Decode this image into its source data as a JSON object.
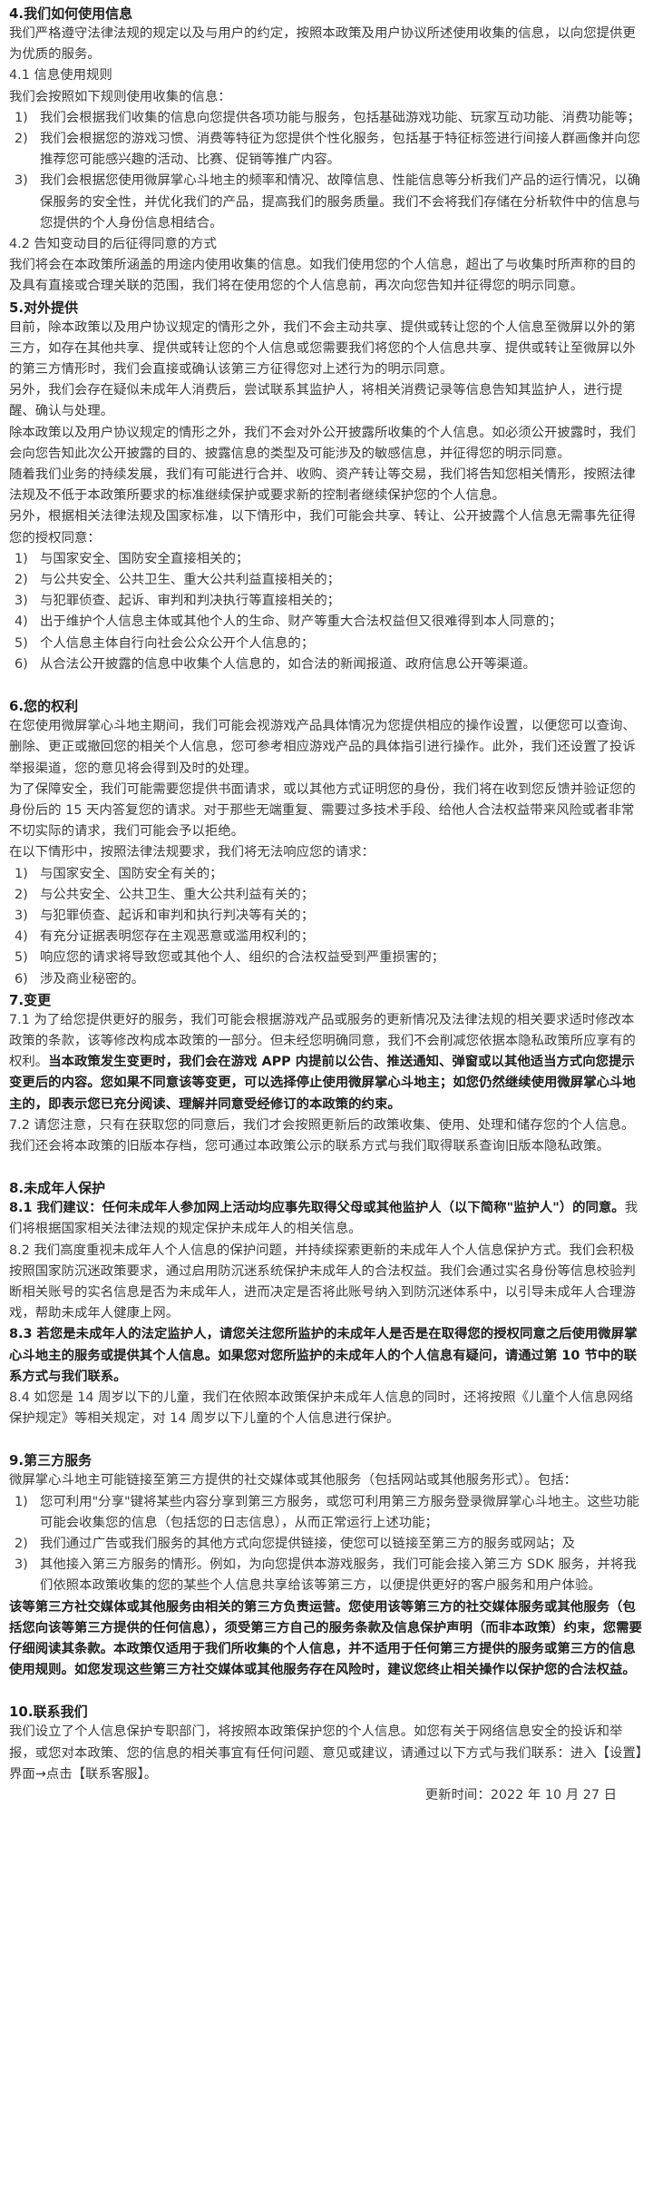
{
  "s4": {
    "title": "4.我们如何使用信息",
    "intro": "我们严格遵守法律法规的规定以及与用户的约定，按照本政策及用户协议所述使用收集的信息，以向您提供更为优质的服务。",
    "s41_title": "4.1 信息使用规则",
    "s41_intro": "我们会按照如下规则使用收集的信息：",
    "items": [
      {
        "n": "1)",
        "t": "我们会根据我们收集的信息向您提供各项功能与服务，包括基础游戏功能、玩家互动功能、消费功能等；"
      },
      {
        "n": "2)",
        "t": "我们会根据您的游戏习惯、消费等特征为您提供个性化服务，包括基于特征标签进行间接人群画像并向您推荐您可能感兴趣的活动、比赛、促销等推广内容。"
      },
      {
        "n": "3)",
        "t": "我们会根据您使用微屏掌心斗地主的频率和情况、故障信息、性能信息等分析我们产品的运行情况，以确保服务的安全性，并优化我们的产品，提高我们的服务质量。我们不会将我们存储在分析软件中的信息与您提供的个人身份信息相结合。"
      }
    ],
    "s42_title": "4.2 告知变动目的后征得同意的方式",
    "s42_text": "我们将会在本政策所涵盖的用途内使用收集的信息。如我们使用您的个人信息，超出了与收集时所声称的目的及具有直接或合理关联的范围，我们将在使用您的个人信息前，再次向您告知并征得您的明示同意。"
  },
  "s5": {
    "title": "5.对外提供",
    "p1": "目前，除本政策以及用户协议规定的情形之外，我们不会主动共享、提供或转让您的个人信息至微屏以外的第三方，如存在其他共享、提供或转让您的个人信息或您需要我们将您的个人信息共享、提供或转让至微屏以外的第三方情形时，我们会直接或确认该第三方征得您对上述行为的明示同意。",
    "p2": "另外，我们会存在疑似未成年人消费后，尝试联系其监护人，将相关消费记录等信息告知其监护人，进行提醒、确认与处理。",
    "p3": "除本政策以及用户协议规定的情形之外，我们不会对外公开披露所收集的个人信息。如必须公开披露时，我们会向您告知此次公开披露的目的、披露信息的类型及可能涉及的敏感信息，并征得您的明示同意。",
    "p4": "随着我们业务的持续发展，我们有可能进行合并、收购、资产转让等交易，我们将告知您相关情形，按照法律法规及不低于本政策所要求的标准继续保护或要求新的控制者继续保护您的个人信息。",
    "p5": "另外，根据相关法律法规及国家标准，以下情形中，我们可能会共享、转让、公开披露个人信息无需事先征得您的授权同意：",
    "items": [
      {
        "n": "1)",
        "t": "与国家安全、国防安全直接相关的；"
      },
      {
        "n": "2)",
        "t": "与公共安全、公共卫生、重大公共利益直接相关的；"
      },
      {
        "n": "3)",
        "t": "与犯罪侦查、起诉、审判和判决执行等直接相关的；"
      },
      {
        "n": "4)",
        "t": "出于维护个人信息主体或其他个人的生命、财产等重大合法权益但又很难得到本人同意的；"
      },
      {
        "n": "5)",
        "t": "个人信息主体自行向社会公众公开个人信息的；"
      },
      {
        "n": "6)",
        "t": "从合法公开披露的信息中收集个人信息的，如合法的新闻报道、政府信息公开等渠道。"
      }
    ]
  },
  "s6": {
    "title": "6.您的权利",
    "p1": "在您使用微屏掌心斗地主期间，我们可能会视游戏产品具体情况为您提供相应的操作设置，以便您可以查询、删除、更正或撤回您的相关个人信息，您可参考相应游戏产品的具体指引进行操作。此外，我们还设置了投诉举报渠道，您的意见将会得到及时的处理。",
    "p2": "为了保障安全，我们可能需要您提供书面请求，或以其他方式证明您的身份，我们将在收到您反馈并验证您的身份后的 15 天内答复您的请求。对于那些无端重复、需要过多技术手段、给他人合法权益带来风险或者非常不切实际的请求，我们可能会予以拒绝。",
    "p3": "在以下情形中，按照法律法规要求，我们将无法响应您的请求：",
    "items": [
      {
        "n": "1)",
        "t": "与国家安全、国防安全有关的；"
      },
      {
        "n": "2)",
        "t": "与公共安全、公共卫生、重大公共利益有关的；"
      },
      {
        "n": "3)",
        "t": "与犯罪侦查、起诉和审判和执行判决等有关的；"
      },
      {
        "n": "4)",
        "t": "有充分证据表明您存在主观恶意或滥用权利的；"
      },
      {
        "n": "5)",
        "t": "响应您的请求将导致您或其他个人、组织的合法权益受到严重损害的；"
      },
      {
        "n": "6)",
        "t": "涉及商业秘密的。"
      }
    ]
  },
  "s7": {
    "title": "7.变更",
    "p1_normal": "7.1 为了给您提供更好的服务，我们可能会根据游戏产品或服务的更新情况及法律法规的相关要求适时修改本政策的条款，该等修改构成本政策的一部分。但未经您明确同意，我们不会削减您依据本隐私政策所应享有的权利。",
    "p1_bold": "当本政策发生变更时，我们会在游戏 APP 内提前以公告、推送通知、弹窗或以其他适当方式向您提示变更后的内容。您如果不同意该等变更，可以选择停止使用微屏掌心斗地主；如您仍然继续使用微屏掌心斗地主的，即表示您已充分阅读、理解并同意受经修订的本政策的约束。",
    "p2": "7.2 请您注意，只有在获取您的同意后，我们才会按照更新后的政策收集、使用、处理和储存您的个人信息。我们还会将本政策的旧版本存档，您可通过本政策公示的联系方式与我们取得联系查询旧版本隐私政策。"
  },
  "s8": {
    "title": "8.未成年人保护",
    "p1_bold": "8.1 我们建议：任何未成年人参加网上活动均应事先取得父母或其他监护人（以下简称\"监护人\"）的同意。",
    "p1_normal": "我们将根据国家相关法律法规的规定保护未成年人的相关信息。",
    "p2": "8.2 我们高度重视未成年人个人信息的保护问题，并持续探索更新的未成年人个人信息保护方式。我们会积极按照国家防沉迷政策要求，通过启用防沉迷系统保护未成年人的合法权益。我们会通过实名身份等信息校验判断相关账号的实名信息是否为未成年人，进而决定是否将此账号纳入到防沉迷体系中，以引导未成年人合理游戏，帮助未成年人健康上网。",
    "p3_bold": "8.3 若您是未成年人的法定监护人，请您关注您所监护的未成年人是否是在取得您的授权同意之后使用微屏掌心斗地主的服务或提供其个人信息。如果您对您所监护的未成年人的个人信息有疑问，请通过第 10 节中的联系方式与我们联系。",
    "p4": "8.4 如您是 14 周岁以下的儿童，我们在依照本政策保护未成年人信息的同时，还将按照《儿童个人信息网络保护规定》等相关规定，对 14 周岁以下儿童的个人信息进行保护。"
  },
  "s9": {
    "title": "9.第三方服务",
    "intro": "微屏掌心斗地主可能链接至第三方提供的社交媒体或其他服务（包括网站或其他服务形式）。包括：",
    "items": [
      {
        "n": "1)",
        "t": "您可利用\"分享\"键将某些内容分享到第三方服务，或您可利用第三方服务登录微屏掌心斗地主。这些功能可能会收集您的信息（包括您的日志信息），从而正常运行上述功能；"
      },
      {
        "n": "2)",
        "t": "我们通过广告或我们服务的其他方式向您提供链接，使您可以链接至第三方的服务或网站；及"
      },
      {
        "n": "3)",
        "t": "其他接入第三方服务的情形。例如，为向您提供本游戏服务，我们可能会接入第三方 SDK 服务，并将我们依照本政策收集的您的某些个人信息共享给该等第三方，以便提供更好的客户服务和用户体验。"
      }
    ],
    "p_bold": "该等第三方社交媒体或其他服务由相关的第三方负责运营。您使用该等第三方的社交媒体服务或其他服务（包括您向该等第三方提供的任何信息），须受第三方自己的服务条款及信息保护声明（而非本政策）约束，您需要仔细阅读其条款。本政策仅适用于我们所收集的个人信息，并不适用于任何第三方提供的服务或第三方的信息使用规则。如您发现这些第三方社交媒体或其他服务存在风险时，建议您终止相关操作以保护您的合法权益。"
  },
  "s10": {
    "title": "10.联系我们",
    "text": "我们设立了个人信息保护专职部门，将按照本政策保护您的个人信息。如您有关于网络信息安全的投诉和举报，或您对本政策、您的信息的相关事宜有任何问题、意见或建议，请通过以下方式与我们联系：进入【设置】界面→点击【联系客服】。",
    "updated": "更新时间：2022 年 10 月 27 日"
  }
}
